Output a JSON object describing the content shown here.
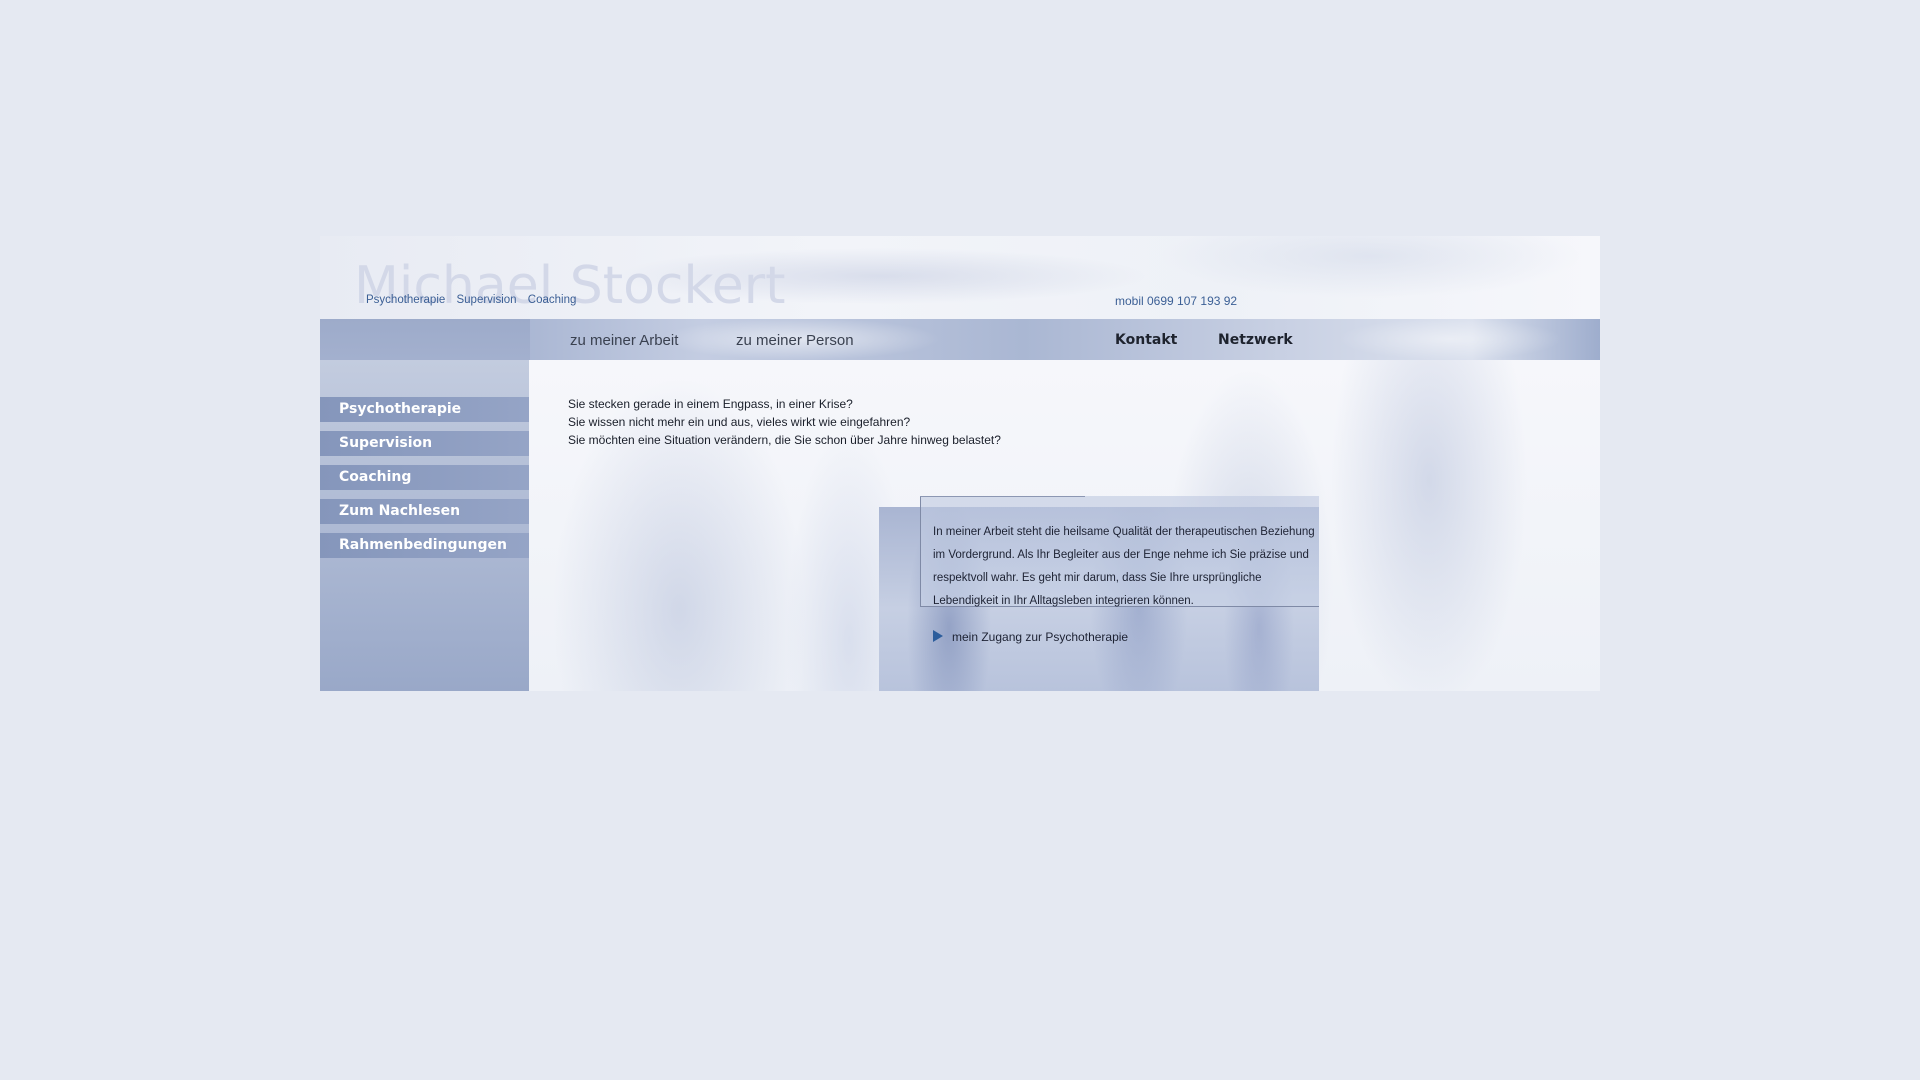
{
  "header": {
    "brand_name": "Michael Stockert",
    "tagline": [
      "Psychotherapie",
      "Supervision",
      "Coaching"
    ],
    "phone": "mobil 0699 107 193 92"
  },
  "topnav": {
    "items": [
      "zu meiner Arbeit",
      "zu meiner Person",
      "Kontakt",
      "Netzwerk"
    ]
  },
  "sidebar": {
    "items": [
      "Psychotherapie",
      "Supervision",
      "Coaching",
      "Zum Nachlesen",
      "Rahmenbedingungen"
    ]
  },
  "main": {
    "intro_lines": [
      "Sie stecken gerade in einem Engpass, in einer Krise?",
      "Sie wissen nicht mehr ein und aus, vieles wirkt wie eingefahren?",
      "Sie möchten eine Situation verändern, die Sie schon über Jahre hinweg belastet?"
    ],
    "quote": "In meiner Arbeit steht die heilsame Qualität der therapeutischen Beziehung im Vordergrund. Als Ihr Begleiter aus der Enge nehme ich Sie präzise und respektvoll wahr. Es geht mir darum, dass Sie Ihre ursprüngliche Lebendigkeit in Ihr Alltagsleben integrieren können.",
    "link": "mein Zugang zur Psychotherapie"
  },
  "colors": {
    "background": "#e5e9f2",
    "accent": "#3b5f95",
    "sidebar_button": "#8596bb",
    "arrow": "#2c5d9c"
  }
}
